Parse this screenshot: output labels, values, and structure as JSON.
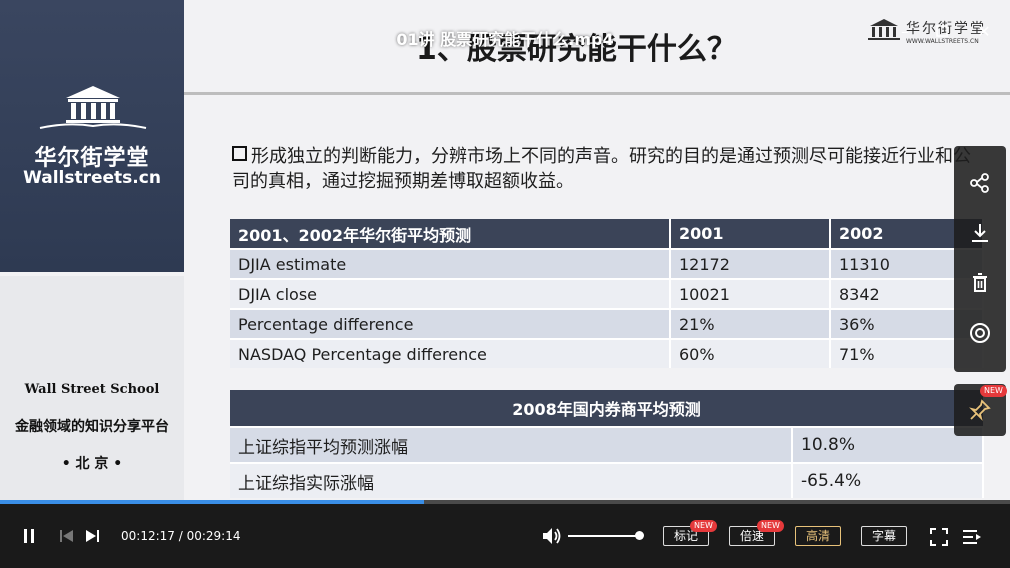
{
  "video": {
    "title": "01讲 股票研究能干什么.mp4",
    "current_time": "00:12:17",
    "total_time": "00:29:14",
    "progress_fraction": 0.42,
    "volume_fraction": 0.92
  },
  "sidebar_logo": {
    "brand_cn": "华尔街学堂",
    "brand_en": "Wallstreets.cn",
    "school_en": "Wall Street School",
    "school_cn": "金融领域的知识分享平台",
    "school_city": "• 北 京 •"
  },
  "corner_logo": {
    "brand_cn": "华尔街学堂",
    "url": "WWW.WALLSTREETS.CN"
  },
  "slide": {
    "title": "1、股票研究能干什么？",
    "paragraph": "形成独立的判断能力，分辨市场上不同的声音。研究的目的是通过预测尽可能接近行业和公司的真相，通过挖掘预期差博取超额收益。",
    "table1": {
      "headers": [
        "2001、2002年华尔街平均预测",
        "2001",
        "2002"
      ],
      "rows": [
        [
          "DJIA estimate",
          "12172",
          "11310"
        ],
        [
          "DJIA close",
          "10021",
          "8342"
        ],
        [
          "Percentage difference",
          "21%",
          "36%"
        ],
        [
          "NASDAQ Percentage difference",
          "60%",
          "71%"
        ]
      ]
    },
    "table2": {
      "header": "2008年国内券商平均预测",
      "rows": [
        [
          "上证综指平均预测涨幅",
          "10.8%"
        ],
        [
          "上证综指实际涨幅",
          "-65.4%"
        ]
      ]
    }
  },
  "controls": {
    "bookmark_label": "标记",
    "speed_label": "倍速",
    "quality_label": "高清",
    "subtitle_label": "字幕",
    "new_badge": "NEW"
  },
  "side_toolbar": {
    "items": [
      "share-icon",
      "download-icon",
      "delete-icon",
      "view-icon"
    ],
    "pin_badge": "NEW"
  },
  "colors": {
    "header_bg": "#3b4458",
    "row_alt": "#d6dbe6",
    "progress": "#3a8ee6",
    "quality_active": "#e8c27a"
  }
}
